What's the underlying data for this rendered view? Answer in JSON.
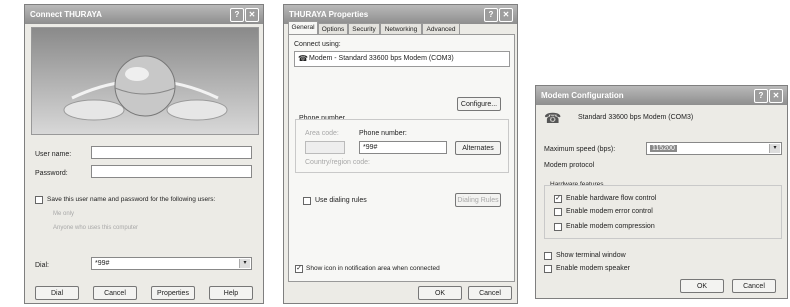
{
  "connect": {
    "title": "Connect THURAYA",
    "user_name_label": "User name:",
    "user_name_value": "",
    "password_label": "Password:",
    "password_value": "",
    "save_label": "Save this user name and password for the following users:",
    "me_only": "Me only",
    "anyone": "Anyone who uses this computer",
    "dial_label": "Dial:",
    "dial_value": "*99#",
    "buttons": {
      "dial": "Dial",
      "cancel": "Cancel",
      "properties": "Properties",
      "help": "Help"
    }
  },
  "properties": {
    "title": "THURAYA Properties",
    "tabs": [
      "General",
      "Options",
      "Security",
      "Networking",
      "Advanced"
    ],
    "connect_using_label": "Connect using:",
    "modem": "Modem - Standard 33600 bps Modem (COM3)",
    "configure": "Configure...",
    "phone_number_header": "Phone number",
    "area_code_label": "Area code:",
    "phone_number_label": "Phone number:",
    "phone_value": "*99#",
    "alternates": "Alternates",
    "country_label": "Country/region code:",
    "use_dialing_rules": "Use dialing rules",
    "dialing_rules_btn": "Dialing Rules",
    "show_icon": "Show icon in notification area when connected",
    "ok": "OK",
    "cancel": "Cancel"
  },
  "modem_config": {
    "title": "Modem Configuration",
    "device": "Standard 33600 bps Modem (COM3)",
    "max_speed_label": "Maximum speed (bps):",
    "max_speed_value": "115200",
    "modem_protocol_label": "Modem protocol",
    "hardware_features": "Hardware features",
    "hw_flow": "Enable hardware flow control",
    "error_control": "Enable modem error control",
    "compression": "Enable modem compression",
    "terminal": "Show terminal window",
    "speaker": "Enable modem speaker",
    "ok": "OK",
    "cancel": "Cancel"
  }
}
